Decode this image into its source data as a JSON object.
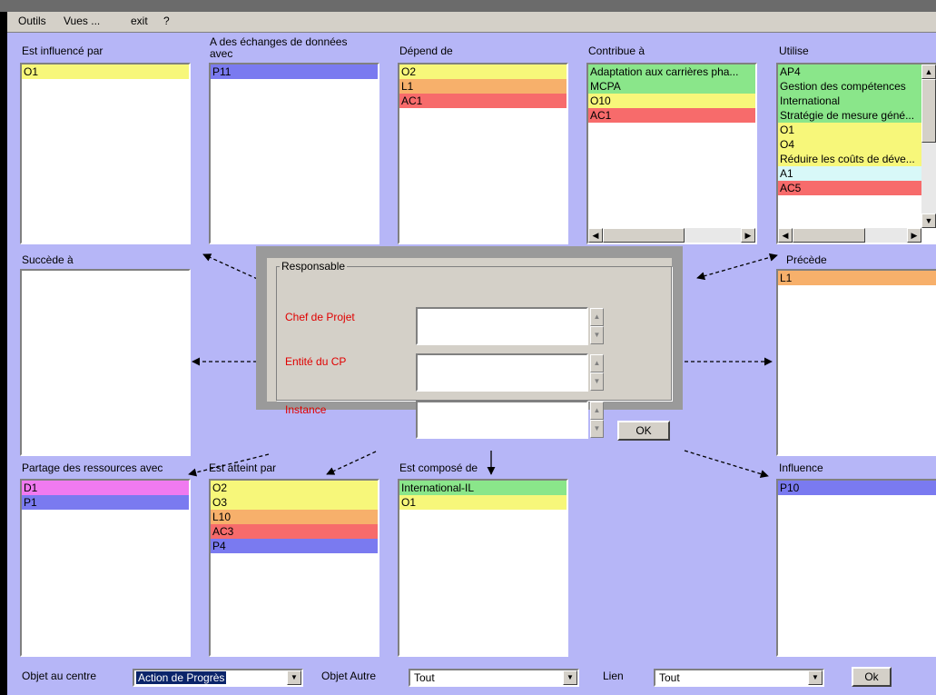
{
  "menu": [
    "Outils",
    "Vues ...",
    "exit",
    "?"
  ],
  "colors": {
    "background": "#b6b6f7",
    "yellow": "#f7f77a",
    "orange": "#f7b06b",
    "red": "#f76b6b",
    "green": "#8ae68a",
    "blue": "#7a7af0",
    "pink": "#f07af0",
    "cyan": "#d8f8f8",
    "label_red": "#e00000"
  },
  "panels": {
    "influence_par": {
      "label": "Est influencé par",
      "items": [
        {
          "text": "O1",
          "color": "yellow"
        }
      ]
    },
    "echanges": {
      "label": "A des échanges de données avec",
      "items": [
        {
          "text": "P11",
          "color": "blue"
        }
      ]
    },
    "depend": {
      "label": "Dépend de",
      "items": [
        {
          "text": "O2",
          "color": "yellow"
        },
        {
          "text": "L1",
          "color": "orange"
        },
        {
          "text": "AC1",
          "color": "red"
        }
      ]
    },
    "contribue": {
      "label": "Contribue à",
      "items": [
        {
          "text": "Adaptation aux carrières pha...",
          "color": "green"
        },
        {
          "text": "MCPA",
          "color": "green"
        },
        {
          "text": "O10",
          "color": "yellow"
        },
        {
          "text": "AC1",
          "color": "red"
        }
      ]
    },
    "utilise": {
      "label": "Utilise",
      "items": [
        {
          "text": "AP4",
          "color": "green"
        },
        {
          "text": "Gestion des compétences",
          "color": "green"
        },
        {
          "text": "International",
          "color": "green"
        },
        {
          "text": "Stratégie de mesure géné...",
          "color": "green"
        },
        {
          "text": "O1",
          "color": "yellow"
        },
        {
          "text": "O4",
          "color": "yellow"
        },
        {
          "text": "Réduire les coûts de déve...",
          "color": "yellow"
        },
        {
          "text": "A1",
          "color": "cyan"
        },
        {
          "text": "AC5",
          "color": "red"
        }
      ]
    },
    "succede": {
      "label": "Succède à",
      "items": []
    },
    "precede": {
      "label": "Précède",
      "items": [
        {
          "text": "L1",
          "color": "orange"
        }
      ]
    },
    "partage": {
      "label": "Partage des ressources avec",
      "items": [
        {
          "text": "D1",
          "color": "pink"
        },
        {
          "text": "P1",
          "color": "blue"
        }
      ]
    },
    "atteint": {
      "label": "Est atteint par",
      "items": [
        {
          "text": "O2",
          "color": "yellow"
        },
        {
          "text": "O3",
          "color": "yellow"
        },
        {
          "text": "L10",
          "color": "orange"
        },
        {
          "text": "AC3",
          "color": "red"
        },
        {
          "text": "P4",
          "color": "blue"
        }
      ]
    },
    "compose": {
      "label": "Est composé de",
      "items": [
        {
          "text": "International-IL",
          "color": "green"
        },
        {
          "text": "O1",
          "color": "yellow"
        }
      ]
    },
    "influence": {
      "label": "Influence",
      "items": [
        {
          "text": "P10",
          "color": "blue"
        }
      ]
    }
  },
  "responsable": {
    "legend": "Responsable",
    "chef": "Chef de Projet",
    "entite": "Entité du CP",
    "instance": "Instance",
    "ok": "OK"
  },
  "footer": {
    "objet_label": "Objet au centre",
    "objet_value": "Action de Progrès",
    "autre_label": "Objet Autre",
    "autre_value": "Tout",
    "lien_label": "Lien",
    "lien_value": "Tout",
    "ok": "Ok"
  }
}
